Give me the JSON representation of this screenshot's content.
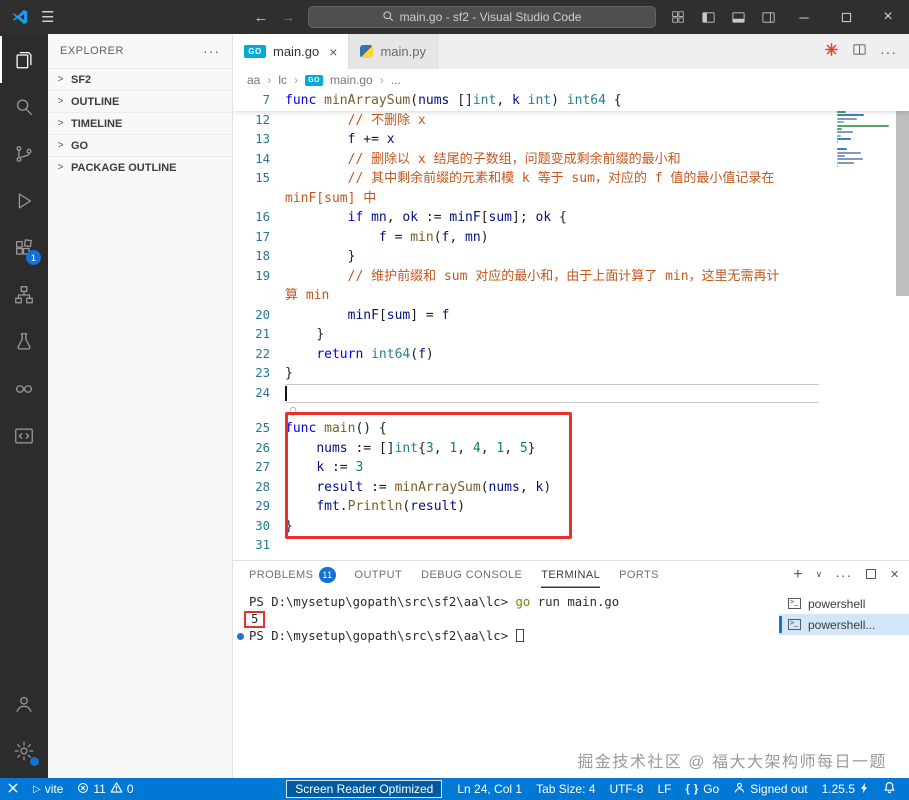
{
  "colors": {
    "statusbar": "#0078d4",
    "annotation": "#e8312a",
    "badge": "#1273d2",
    "comment": "#c2571e"
  },
  "titlebar": {
    "search": "main.go - sf2 - Visual Studio Code"
  },
  "activitybar": {
    "extensions_badge": "1"
  },
  "sidebar": {
    "title": "EXPLORER",
    "sections": [
      {
        "label": "SF2"
      },
      {
        "label": "OUTLINE"
      },
      {
        "label": "TIMELINE"
      },
      {
        "label": "GO"
      },
      {
        "label": "PACKAGE OUTLINE"
      }
    ]
  },
  "tabs": [
    {
      "label": "main.go",
      "icon": "go",
      "active": true
    },
    {
      "label": "main.py",
      "icon": "py",
      "active": false
    }
  ],
  "breadcrumb": [
    {
      "label": "aa"
    },
    {
      "label": "lc"
    },
    {
      "label": "main.go",
      "icon": "go"
    },
    {
      "label": "..."
    }
  ],
  "editor": {
    "sticky": {
      "num": "7",
      "tokens": [
        [
          "func",
          "kw"
        ],
        [
          " ",
          ""
        ],
        [
          "minArraySum",
          "fn"
        ],
        [
          "(",
          "pu"
        ],
        [
          "nums",
          "va"
        ],
        [
          " ",
          ""
        ],
        [
          "[]",
          "pu"
        ],
        [
          "int",
          "ty"
        ],
        [
          ", ",
          "pu"
        ],
        [
          "k",
          "va"
        ],
        [
          " ",
          ""
        ],
        [
          "int",
          "ty"
        ],
        [
          ") ",
          "pu"
        ],
        [
          "int64",
          "ty"
        ],
        [
          " {",
          "pu"
        ]
      ]
    },
    "lines": [
      {
        "num": "12",
        "tokens": [
          [
            "        ",
            ""
          ],
          [
            "// 不删除 x",
            "cm"
          ]
        ]
      },
      {
        "num": "13",
        "tokens": [
          [
            "        ",
            ""
          ],
          [
            "f",
            "va"
          ],
          [
            " += ",
            "pu"
          ],
          [
            "x",
            "va"
          ]
        ]
      },
      {
        "num": "14",
        "tokens": [
          [
            "        ",
            ""
          ],
          [
            "// 删除以 x 结尾的子数组，问题变成剩余前缀的最小和",
            "cm"
          ]
        ]
      },
      {
        "num": "15",
        "tokens": [
          [
            "        ",
            ""
          ],
          [
            "// 其中剩余前缀的元素和模 k 等于 sum，对应的 f 值的最小值记录在",
            "cm"
          ]
        ]
      },
      {
        "num": "",
        "tokens": [
          [
            "minF[sum] 中",
            "cm"
          ]
        ]
      },
      {
        "num": "16",
        "tokens": [
          [
            "        ",
            ""
          ],
          [
            "if",
            "kw"
          ],
          [
            " ",
            ""
          ],
          [
            "mn",
            "va"
          ],
          [
            ", ",
            "pu"
          ],
          [
            "ok",
            "va"
          ],
          [
            " := ",
            "pu"
          ],
          [
            "minF",
            "va"
          ],
          [
            "[",
            "pu"
          ],
          [
            "sum",
            "va"
          ],
          [
            "]; ",
            "pu"
          ],
          [
            "ok",
            "va"
          ],
          [
            " {",
            "pu"
          ]
        ]
      },
      {
        "num": "17",
        "tokens": [
          [
            "            ",
            ""
          ],
          [
            "f",
            "va"
          ],
          [
            " = ",
            "pu"
          ],
          [
            "min",
            "fn"
          ],
          [
            "(",
            "pu"
          ],
          [
            "f",
            "va"
          ],
          [
            ", ",
            "pu"
          ],
          [
            "mn",
            "va"
          ],
          [
            ")",
            "pu"
          ]
        ]
      },
      {
        "num": "18",
        "tokens": [
          [
            "        ",
            ""
          ],
          [
            "}",
            "pu"
          ]
        ]
      },
      {
        "num": "19",
        "tokens": [
          [
            "        ",
            ""
          ],
          [
            "// 维护前缀和 sum 对应的最小和，由于上面计算了 min，这里无需再计",
            "cm"
          ]
        ]
      },
      {
        "num": "",
        "tokens": [
          [
            "算 min",
            "cm"
          ]
        ]
      },
      {
        "num": "20",
        "tokens": [
          [
            "        ",
            ""
          ],
          [
            "minF",
            "va"
          ],
          [
            "[",
            "pu"
          ],
          [
            "sum",
            "va"
          ],
          [
            "] = ",
            "pu"
          ],
          [
            "f",
            "va"
          ]
        ]
      },
      {
        "num": "21",
        "tokens": [
          [
            "    ",
            ""
          ],
          [
            "}",
            "pu"
          ]
        ]
      },
      {
        "num": "22",
        "tokens": [
          [
            "    ",
            ""
          ],
          [
            "return",
            "kw"
          ],
          [
            " ",
            ""
          ],
          [
            "int64",
            "ty"
          ],
          [
            "(",
            "pu"
          ],
          [
            "f",
            "va"
          ],
          [
            ")",
            "pu"
          ]
        ]
      },
      {
        "num": "23",
        "tokens": [
          [
            "}",
            "pu"
          ]
        ]
      },
      {
        "num": "24",
        "tokens": [],
        "cursor": true,
        "current": true
      },
      {
        "num": "25",
        "tokens": [
          [
            "func",
            "kw"
          ],
          [
            " ",
            ""
          ],
          [
            "main",
            "fn"
          ],
          [
            "() {",
            "pu"
          ]
        ],
        "lens": true
      },
      {
        "num": "26",
        "tokens": [
          [
            "    ",
            ""
          ],
          [
            "nums",
            "va"
          ],
          [
            " := ",
            "pu"
          ],
          [
            "[]",
            "pu"
          ],
          [
            "int",
            "ty"
          ],
          [
            "{",
            "pu"
          ],
          [
            "3",
            "nu"
          ],
          [
            ", ",
            "pu"
          ],
          [
            "1",
            "nu"
          ],
          [
            ", ",
            "pu"
          ],
          [
            "4",
            "nu"
          ],
          [
            ", ",
            "pu"
          ],
          [
            "1",
            "nu"
          ],
          [
            ", ",
            "pu"
          ],
          [
            "5",
            "nu"
          ],
          [
            "}",
            "pu"
          ]
        ]
      },
      {
        "num": "27",
        "tokens": [
          [
            "    ",
            ""
          ],
          [
            "k",
            "va"
          ],
          [
            " := ",
            "pu"
          ],
          [
            "3",
            "nu"
          ]
        ]
      },
      {
        "num": "28",
        "tokens": [
          [
            "    ",
            ""
          ],
          [
            "result",
            "va"
          ],
          [
            " := ",
            "pu"
          ],
          [
            "minArraySum",
            "fn"
          ],
          [
            "(",
            "pu"
          ],
          [
            "nums",
            "va"
          ],
          [
            ", ",
            "pu"
          ],
          [
            "k",
            "va"
          ],
          [
            ")",
            "pu"
          ]
        ]
      },
      {
        "num": "29",
        "tokens": [
          [
            "    ",
            ""
          ],
          [
            "fmt",
            "va"
          ],
          [
            ".",
            "pu"
          ],
          [
            "Println",
            "fn"
          ],
          [
            "(",
            "pu"
          ],
          [
            "result",
            "va"
          ],
          [
            ")",
            "pu"
          ]
        ]
      },
      {
        "num": "30",
        "tokens": [
          [
            "}",
            "pu"
          ]
        ]
      },
      {
        "num": "31",
        "tokens": []
      }
    ]
  },
  "panel": {
    "tabs": [
      {
        "label": "PROBLEMS",
        "badge": "11"
      },
      {
        "label": "OUTPUT"
      },
      {
        "label": "DEBUG CONSOLE"
      },
      {
        "label": "TERMINAL",
        "active": true
      },
      {
        "label": "PORTS"
      }
    ],
    "terminal_lines": [
      {
        "tokens": [
          [
            "PS D:\\mysetup\\gopath\\src\\sf2\\aa\\lc> ",
            "t"
          ],
          [
            "go",
            "tg"
          ],
          [
            " run main.go",
            "t"
          ]
        ]
      },
      {
        "tokens": [
          [
            "5",
            "t"
          ]
        ],
        "boxed": true
      },
      {
        "tokens": [
          [
            "PS D:\\mysetup\\gopath\\src\\sf2\\aa\\lc> ",
            "t"
          ]
        ],
        "dot": true,
        "cursor": true
      }
    ],
    "terminals": [
      {
        "label": "powershell"
      },
      {
        "label": "powershell...",
        "active": true
      }
    ]
  },
  "statusbar": {
    "vite": "vite",
    "errors": "11",
    "warnings": "0",
    "screen_reader": "Screen Reader Optimized",
    "cursor_pos": "Ln 24, Col 1",
    "tab_size": "Tab Size: 4",
    "encoding": "UTF-8",
    "eol": "LF",
    "language": "Go",
    "account": "Signed out",
    "version": "1.25.5"
  },
  "watermark": "掘金技术社区 @ 福大大架构师每日一题"
}
